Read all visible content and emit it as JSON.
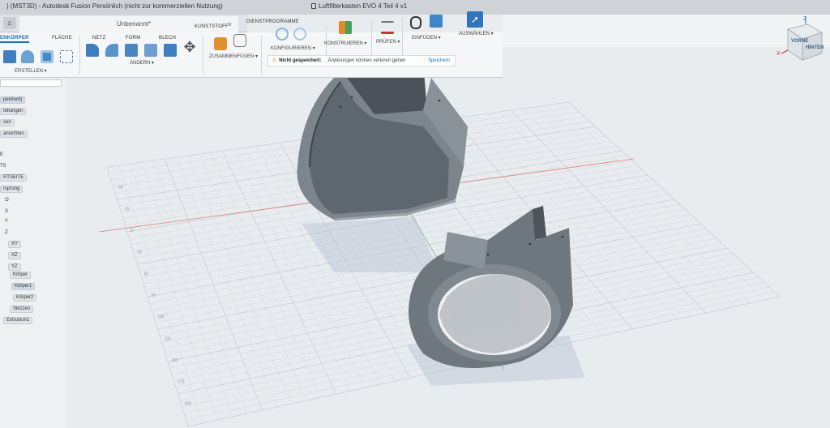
{
  "window": {
    "app_title": ") (MST3D) - Autodesk Fusion Persönlich (nicht zur kommerziellen Nutzung)",
    "doc_title": "Luftfilterkasten EVO 4 Teil 4 v1"
  },
  "tabs": {
    "home_icon": "⌂",
    "active_doc": "Unbenannt*",
    "close_icon": "×"
  },
  "ribbon": {
    "workspace_tabs": [
      "ENKÖRPER",
      "FLÄCHE",
      "NETZ",
      "FORM",
      "BLECH",
      "KUNSTSTOFF",
      "DIENSTPROGRAMME"
    ],
    "groups": {
      "create": "ERSTELLEN ▾",
      "modify": "ÄNDERN ▾",
      "assemble": "ZUSAMMENFÜGEN ▾",
      "configure": "KONFIGURIEREN ▾",
      "construct": "KONSTRUIEREN ▾",
      "inspect": "PRÜFEN ▾",
      "insert": "EINFÜGEN ▾",
      "select": "AUSWÄHLEN ▾"
    },
    "icons": [
      "extrude-icon",
      "revolve-icon",
      "shell-icon",
      "sketch-pattern-icon",
      "push-pull-icon",
      "fillet-icon",
      "chamfer-icon",
      "combine-icon",
      "move-icon",
      "joint-icon",
      "as-built-joint-icon",
      "parameters-icon",
      "configure-icon",
      "plane-icon",
      "measure-icon",
      "insert-link-icon",
      "image-icon",
      "select-cursor-icon"
    ]
  },
  "notification": {
    "warning_icon": "⚠",
    "not_saved": "Nicht gespeichert:",
    "message": "Änderungen können verloren gehen",
    "save_link": "Speichern"
  },
  "browser": {
    "rows": [
      "peichert)",
      "tellungen",
      "sen",
      "ansichten",
      "E",
      "TS",
      "RTSEITE",
      "rsprung",
      "O",
      "X",
      "Y",
      "Z",
      "XY",
      "XZ",
      "YZ",
      "Körper",
      "Körper1",
      "Körper2",
      "Skizzen",
      "Extrusion1"
    ]
  },
  "viewport": {
    "grid_tick_labels": [
      "-50",
      "-25",
      "0",
      "25",
      "50",
      "75",
      "100",
      "125",
      "150",
      "175",
      "200"
    ],
    "grid_color": "#c9ced4",
    "body_color": "#6f7780",
    "axis_red": "#d9534f",
    "axis_green": "#3fa34d"
  },
  "viewcube": {
    "front": "VORNE",
    "back": "HINTEN",
    "z": "Z",
    "x": "X"
  }
}
